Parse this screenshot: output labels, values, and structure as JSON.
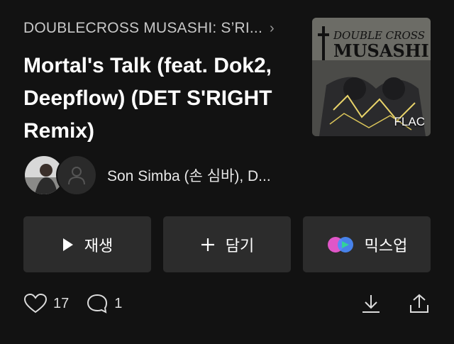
{
  "album": {
    "title": "DOUBLECROSS MUSASHI: S’RI...",
    "chevron": "chevron-right-icon"
  },
  "track": {
    "title": "Mortal's Talk (feat. Dok2, Deepflow) (DET S'RIGHT Remix)"
  },
  "cover": {
    "badge": "FLAC",
    "art_text_top": "DOUBLE CROSS",
    "art_text_main": "MUSASHI"
  },
  "artists": {
    "names": "Son Simba (손 심바), D..."
  },
  "actions": {
    "play_label": "재생",
    "add_label": "담기",
    "mixup_label": "믹스업"
  },
  "stats": {
    "likes": "17",
    "comments": "1"
  },
  "colors": {
    "background": "#121212",
    "button": "#2c2c2c",
    "mixup_pink": "#e056c8",
    "mixup_blue": "#4a8cff",
    "mixup_green": "#32d29a"
  }
}
